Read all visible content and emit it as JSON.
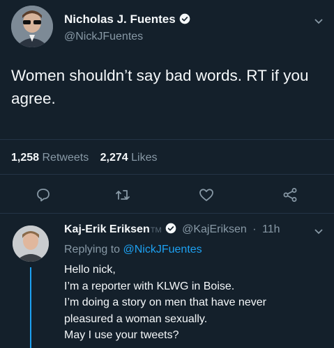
{
  "tweet": {
    "display_name": "Nicholas J. Fuentes",
    "handle": "@NickJFuentes",
    "text": "Women shouldn’t say bad words. RT if you agree.",
    "retweets_count": "1,258",
    "retweets_label": "Retweets",
    "likes_count": "2,274",
    "likes_label": "Likes"
  },
  "reply": {
    "display_name": "Kaj-Erik Eriksen",
    "tm_mark": "TM",
    "handle": "@KajEriksen",
    "separator": "·",
    "time": "11h",
    "replying_prefix": "Replying to",
    "replying_to": "@NickJFuentes",
    "body_lines": [
      "Hello nick,",
      "I’m a reporter with KLWG in Boise.",
      "I’m doing a story on men that have never",
      "pleasured a woman sexually.",
      "May I use your tweets?"
    ]
  },
  "icons": {
    "caret": "chevron-down-icon",
    "verified": "verified-badge-icon",
    "reply": "reply-icon",
    "retweet": "retweet-icon",
    "like": "heart-icon",
    "share": "share-icon"
  },
  "colors": {
    "background": "#14202b",
    "text": "#f5f8fa",
    "secondary": "#8899a6",
    "accent": "#1da1f2",
    "divider": "#243447"
  }
}
